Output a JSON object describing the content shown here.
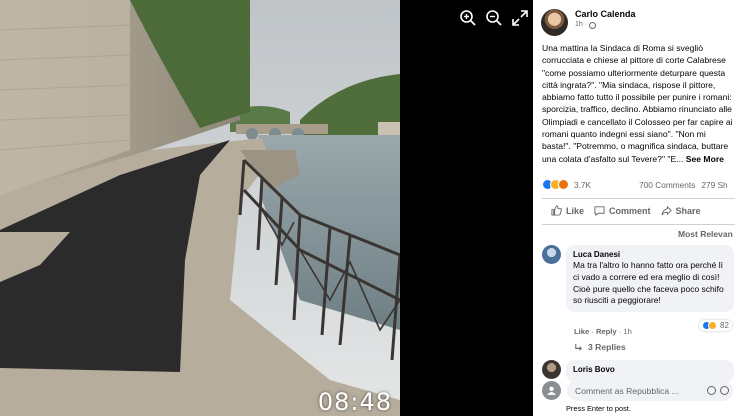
{
  "viewer": {
    "video_time": "08:48",
    "controls": [
      {
        "name": "zoom-in-icon"
      },
      {
        "name": "zoom-out-icon"
      },
      {
        "name": "fullscreen-icon"
      }
    ]
  },
  "post": {
    "author": "Carlo Calenda",
    "time": "1h · ",
    "text": "Una mattina la Sindaca di Roma si svegliò\ncorrucciata e chiese al pittore di corte Calabrese\n\"come possiamo ulteriormente deturpare questa\ncittà ingrata?\". \"Mia sindaca, rispose il pittore,\nabbiamo fatto tutto il possibile per punire i romani:\nsporcizia, traffico, declino. Abbiamo rinunciato alle\nOlimpiadi e cancellato il Colosseo per far capire ai\nromani quanto indegni essi siano\". \"Non mi\nbasta!\". \"Potremmo, o magnifica sindaca, buttare\nuna colata d'asfalto sul Tevere?\" \"E... ",
    "see_more": "See More",
    "reactions_count": "3.7K",
    "comments_count": "700 Comments",
    "shares_count": "279 Sh",
    "actions": {
      "like": "Like",
      "comment": "Comment",
      "share": "Share"
    },
    "sort_label": "Most Relevan"
  },
  "comments": [
    {
      "author": "Luca Danesi",
      "text": "Ma tra l'altro lo hanno fatto ora perché lì ci vado a correre ed era meglio di così! Cioè pure quello che faceva poco schifo so riusciti a peggiorare!",
      "like_label": "Like",
      "reply_label": "Reply",
      "time": "1h",
      "reactions": "82",
      "replies_label": "3 Replies"
    },
    {
      "author": "Loris Bovo"
    }
  ],
  "composer": {
    "placeholder": "Comment as Repubblica ...",
    "hint": "Press Enter to post."
  }
}
